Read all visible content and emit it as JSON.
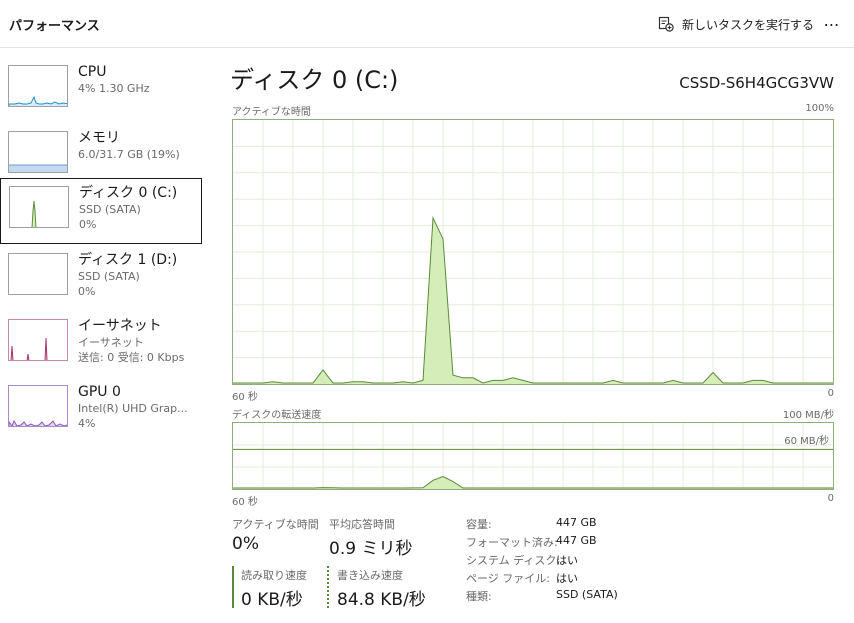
{
  "header": {
    "title": "パフォーマンス",
    "run_task": "新しいタスクを実行する",
    "more": "⋯"
  },
  "sidebar": {
    "items": [
      {
        "name": "CPU",
        "sub1": "4%  1.30 GHz",
        "sub2": ""
      },
      {
        "name": "メモリ",
        "sub1": "6.0/31.7 GB (19%)",
        "sub2": ""
      },
      {
        "name": "ディスク 0 (C:)",
        "sub1": "SSD (SATA)",
        "sub2": "0%"
      },
      {
        "name": "ディスク 1 (D:)",
        "sub1": "SSD (SATA)",
        "sub2": "0%"
      },
      {
        "name": "イーサネット",
        "sub1": "イーサネット",
        "sub2": "送信: 0 受信: 0 Kbps"
      },
      {
        "name": "GPU 0",
        "sub1": "Intel(R) UHD Grap...",
        "sub2": "4%"
      }
    ],
    "selected_index": 2
  },
  "main": {
    "title": "ディスク 0 (C:)",
    "model": "CSSD-S6H4GCG3VW",
    "active_graph": {
      "label": "アクティブな時間",
      "max_label": "100%",
      "x_left": "60 秒",
      "x_right": "0",
      "unit": "percent",
      "ymax": 100,
      "values": [
        0,
        0,
        0,
        0,
        0.5,
        0,
        0,
        0,
        0,
        5,
        0,
        0,
        0.5,
        0.5,
        0,
        0,
        0,
        0.5,
        0,
        1,
        63,
        55,
        3,
        2,
        2,
        0,
        1,
        1,
        2,
        1,
        0,
        0,
        0,
        0,
        0,
        0,
        0,
        0,
        1,
        0,
        0,
        0,
        0,
        0,
        1,
        0,
        0,
        0,
        4,
        0,
        0,
        0,
        1,
        1,
        0,
        0,
        0,
        0,
        0,
        0,
        0
      ]
    },
    "transfer_graph": {
      "label": "ディスクの転送速度",
      "max_label": "100 MB/秒",
      "ref_label": "60 MB/秒",
      "ref_value": 60,
      "ymax": 100,
      "x_left": "60 秒",
      "x_right": "0",
      "values": [
        0,
        0,
        0,
        0,
        0,
        0,
        0,
        0,
        0,
        0.6,
        0.3,
        0,
        0,
        0,
        0,
        0,
        0,
        0,
        0.2,
        0.3,
        12,
        18,
        10,
        0,
        0,
        0,
        0,
        0,
        0,
        0,
        0,
        0,
        0,
        0,
        0,
        0,
        0,
        0,
        0,
        0,
        0,
        0,
        0,
        0,
        0,
        0,
        0,
        0,
        0,
        0,
        0,
        0,
        0,
        0,
        0,
        0,
        0,
        0,
        0,
        0,
        0
      ]
    },
    "stats": {
      "active_time_label": "アクティブな時間",
      "active_time_value": "0%",
      "avg_response_label": "平均応答時間",
      "avg_response_value": "0.9 ミリ秒",
      "read_label": "読み取り速度",
      "read_value": "0 KB/秒",
      "write_label": "書き込み速度",
      "write_value": "84.8 KB/秒"
    },
    "properties": [
      {
        "key": "容量:",
        "value": "447 GB"
      },
      {
        "key": "フォーマット済み:",
        "value": "447 GB"
      },
      {
        "key": "システム ディスク:",
        "value": "はい"
      },
      {
        "key": "ページ ファイル:",
        "value": "はい"
      },
      {
        "key": "種類:",
        "value": "SSD (SATA)"
      }
    ]
  },
  "colors": {
    "disk_line": "#5c8a3a",
    "disk_fill": "#d5edb8",
    "disk_border": "#8fae7c",
    "grid": "#e3ecd9",
    "cpu": "#1f8ec5",
    "memory": "#6a9bd3",
    "ethernet": "#a8326b",
    "gpu": "#8a53c4"
  }
}
